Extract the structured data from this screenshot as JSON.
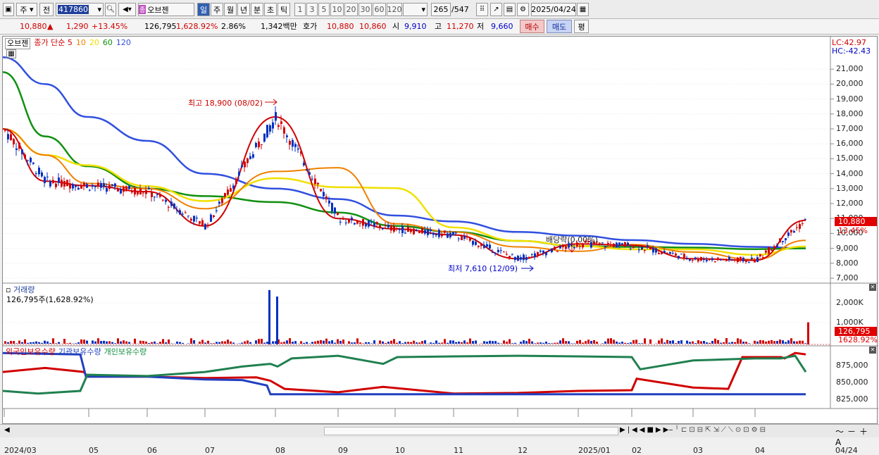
{
  "toolbar": {
    "market": "주",
    "prev": "전",
    "code": "417860",
    "name": "오브젠",
    "period_tabs": [
      "일",
      "주",
      "월",
      "년",
      "분",
      "초",
      "틱"
    ],
    "intervals": [
      "1",
      "3",
      "5",
      "10",
      "20",
      "30",
      "60",
      "120"
    ],
    "count": "265",
    "total": "/547",
    "date": "2025/04/24"
  },
  "info": {
    "price": "10,880",
    "change_arrow": "▲",
    "change": "1,290",
    "change_pct": "+13.45%",
    "volume": "126,795",
    "volume_pct": "1,628.92%",
    "turnover_rate": "2.86%",
    "amount": "1,342백만",
    "bid_label": "호가",
    "ask_price": "10,880",
    "bid_price": "10,860",
    "open_label": "시",
    "open": "9,910",
    "high_label": "고",
    "high": "11,270",
    "low_label": "저",
    "low": "9,660",
    "buy": "매수",
    "sell": "매도",
    "avg": "평"
  },
  "price_panel": {
    "name": "오브젠",
    "legend": [
      {
        "label": "종가 단순 5",
        "color": "#d00000"
      },
      {
        "label": "10",
        "color": "#f08000"
      },
      {
        "label": "20",
        "color": "#f0e000"
      },
      {
        "label": "60",
        "color": "#109010"
      },
      {
        "label": "120",
        "color": "#3050e0"
      }
    ],
    "lc": "LC:42.97",
    "hc": "HC:-42.43",
    "high_note": "최고 18,900 (08/02)",
    "low_note": "최저 7,610 (12/09)",
    "div_note": "배당락(0.00%)",
    "last_price": "10,880",
    "last_pct": "13.45%",
    "y_ticks": [
      "21,000",
      "20,000",
      "19,000",
      "18,000",
      "17,000",
      "16,000",
      "15,000",
      "14,000",
      "13,000",
      "12,000",
      "11,000",
      "10,000",
      "9,000",
      "8,000",
      "7,000"
    ]
  },
  "volume_panel": {
    "title": "거래량",
    "value": "126,795주(1,628.92%)",
    "y_ticks": [
      "2,000K",
      "1,000K"
    ],
    "last_value": "126,795",
    "last_pct": "1628.92%"
  },
  "holding_panel": {
    "legend": [
      "외국인보유수량",
      "기관보유수량",
      "개인보유수량"
    ],
    "y_ticks": [
      "875,000",
      "850,000",
      "825,000"
    ]
  },
  "x_ticks": [
    "2024/03",
    "05",
    "06",
    "07",
    "08",
    "09",
    "10",
    "11",
    "12",
    "2025/01",
    "02",
    "03",
    "04",
    "04/24"
  ],
  "colors": {
    "up": "#d00000",
    "down": "#0030c0",
    "ma5": "#d00000",
    "ma10": "#f08000",
    "ma20": "#f0e000",
    "ma60": "#109010",
    "ma120": "#3050e0"
  },
  "chart_data": {
    "type": "line",
    "x": [
      "2024/03",
      "04",
      "05",
      "06",
      "07",
      "08",
      "09",
      "10",
      "11",
      "12",
      "2025/01",
      "02",
      "03",
      "04",
      "04/24"
    ],
    "series": [
      {
        "name": "종가",
        "values": [
          17000,
          13500,
          13200,
          12800,
          10500,
          17800,
          11000,
          10300,
          9900,
          8300,
          9300,
          9200,
          8300,
          8200,
          10880
        ]
      },
      {
        "name": "120",
        "values": [
          21800,
          20000,
          17800,
          16200,
          14000,
          13000,
          12300,
          11200,
          10800,
          10100,
          9850,
          9550,
          9300,
          9100,
          9000
        ]
      },
      {
        "name": "60",
        "values": [
          20800,
          16500,
          14500,
          13000,
          12500,
          12100,
          11400,
          10500,
          10100,
          9500,
          9150,
          9100,
          9050,
          8950,
          9000
        ]
      }
    ],
    "volume": [
      {
        "x": "08",
        "value": 2650000
      },
      {
        "x": "08",
        "value": 2320000
      },
      {
        "x": "04/24",
        "value": 126795
      }
    ]
  }
}
